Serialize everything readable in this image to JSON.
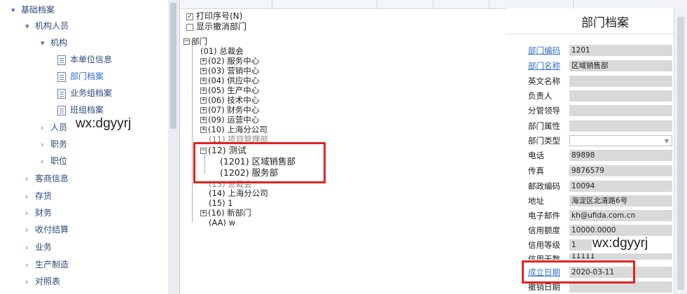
{
  "nav": {
    "items": [
      {
        "label": "基础档案",
        "chev": "▾"
      },
      {
        "label": "机构人员",
        "chev": "▾"
      },
      {
        "label": "机构",
        "chev": "▾"
      },
      {
        "label": "本单位信息",
        "icon": "document-icon"
      },
      {
        "label": "部门档案",
        "icon": "document-icon"
      },
      {
        "label": "业务组档案",
        "icon": "document-icon"
      },
      {
        "label": "班组档案",
        "icon": "document-icon"
      },
      {
        "label": "人员",
        "chev": "›"
      },
      {
        "label": "职务",
        "chev": "›"
      },
      {
        "label": "职位",
        "chev": "›"
      },
      {
        "label": "客商信息",
        "chev": "›"
      },
      {
        "label": "存货",
        "chev": "›"
      },
      {
        "label": "财务",
        "chev": "›"
      },
      {
        "label": "收付结算",
        "chev": "›"
      },
      {
        "label": "业务",
        "chev": "›"
      },
      {
        "label": "生产制造",
        "chev": "›"
      },
      {
        "label": "对照表",
        "chev": "›"
      }
    ]
  },
  "watermark": "wx:dgyyrj",
  "options": {
    "print_seq": "打印序号(N)",
    "print_seq_check": "✓",
    "show_cancelled": "显示撤消部门"
  },
  "tree": {
    "root": "部门",
    "nodes": [
      {
        "text": "(01) 总裁会",
        "box": ""
      },
      {
        "text": "(02) 服务中心",
        "box": "+"
      },
      {
        "text": "(03) 营销中心",
        "box": "+"
      },
      {
        "text": "(04) 供应中心",
        "box": "+"
      },
      {
        "text": "(05) 生产中心",
        "box": "+"
      },
      {
        "text": "(06) 技术中心",
        "box": "+"
      },
      {
        "text": "(07) 财务中心",
        "box": "+"
      },
      {
        "text": "(09) 运营中心",
        "box": "+"
      },
      {
        "text": "(10) 上海分公司",
        "box": "+"
      },
      {
        "text": "(11) 项目管理部",
        "box": ""
      },
      {
        "text": "(12) 测试",
        "box": "−"
      },
      {
        "text": "(1201) 区域销售部",
        "box": ""
      },
      {
        "text": "(1202) 服务部",
        "box": ""
      },
      {
        "text": "(13) 总裁会",
        "box": ""
      },
      {
        "text": "(14) 上海分公司",
        "box": ""
      },
      {
        "text": "(15) 1",
        "box": ""
      },
      {
        "text": "(16) 新部门",
        "box": "+"
      },
      {
        "text": "(AA) w",
        "box": ""
      }
    ]
  },
  "panel": {
    "title": "部门档案",
    "fields": [
      {
        "label": "部门编码",
        "value": "1201",
        "link": true
      },
      {
        "label": "部门名称",
        "value": "区域销售部",
        "link": true
      },
      {
        "label": "英文名称",
        "value": ""
      },
      {
        "label": "负责人",
        "value": ""
      },
      {
        "label": "分管领导",
        "value": ""
      },
      {
        "label": "部门属性",
        "value": ""
      },
      {
        "label": "部门类型",
        "value": "",
        "select": true
      },
      {
        "label": "电话",
        "value": "89898"
      },
      {
        "label": "传真",
        "value": "9876579"
      },
      {
        "label": "邮政编码",
        "value": "10094"
      },
      {
        "label": "地址",
        "value": "海淀区北清路6号"
      },
      {
        "label": "电子邮件",
        "value": "kh@ufida.com.cn"
      },
      {
        "label": "信用额度",
        "value": "10000.0000"
      },
      {
        "label": "信用等级",
        "value": "1"
      },
      {
        "label": "信用天数",
        "value": "11111"
      },
      {
        "label": "成立日期",
        "value": "2020-03-11",
        "link": true
      },
      {
        "label": "撤销日期",
        "value": ""
      }
    ]
  }
}
